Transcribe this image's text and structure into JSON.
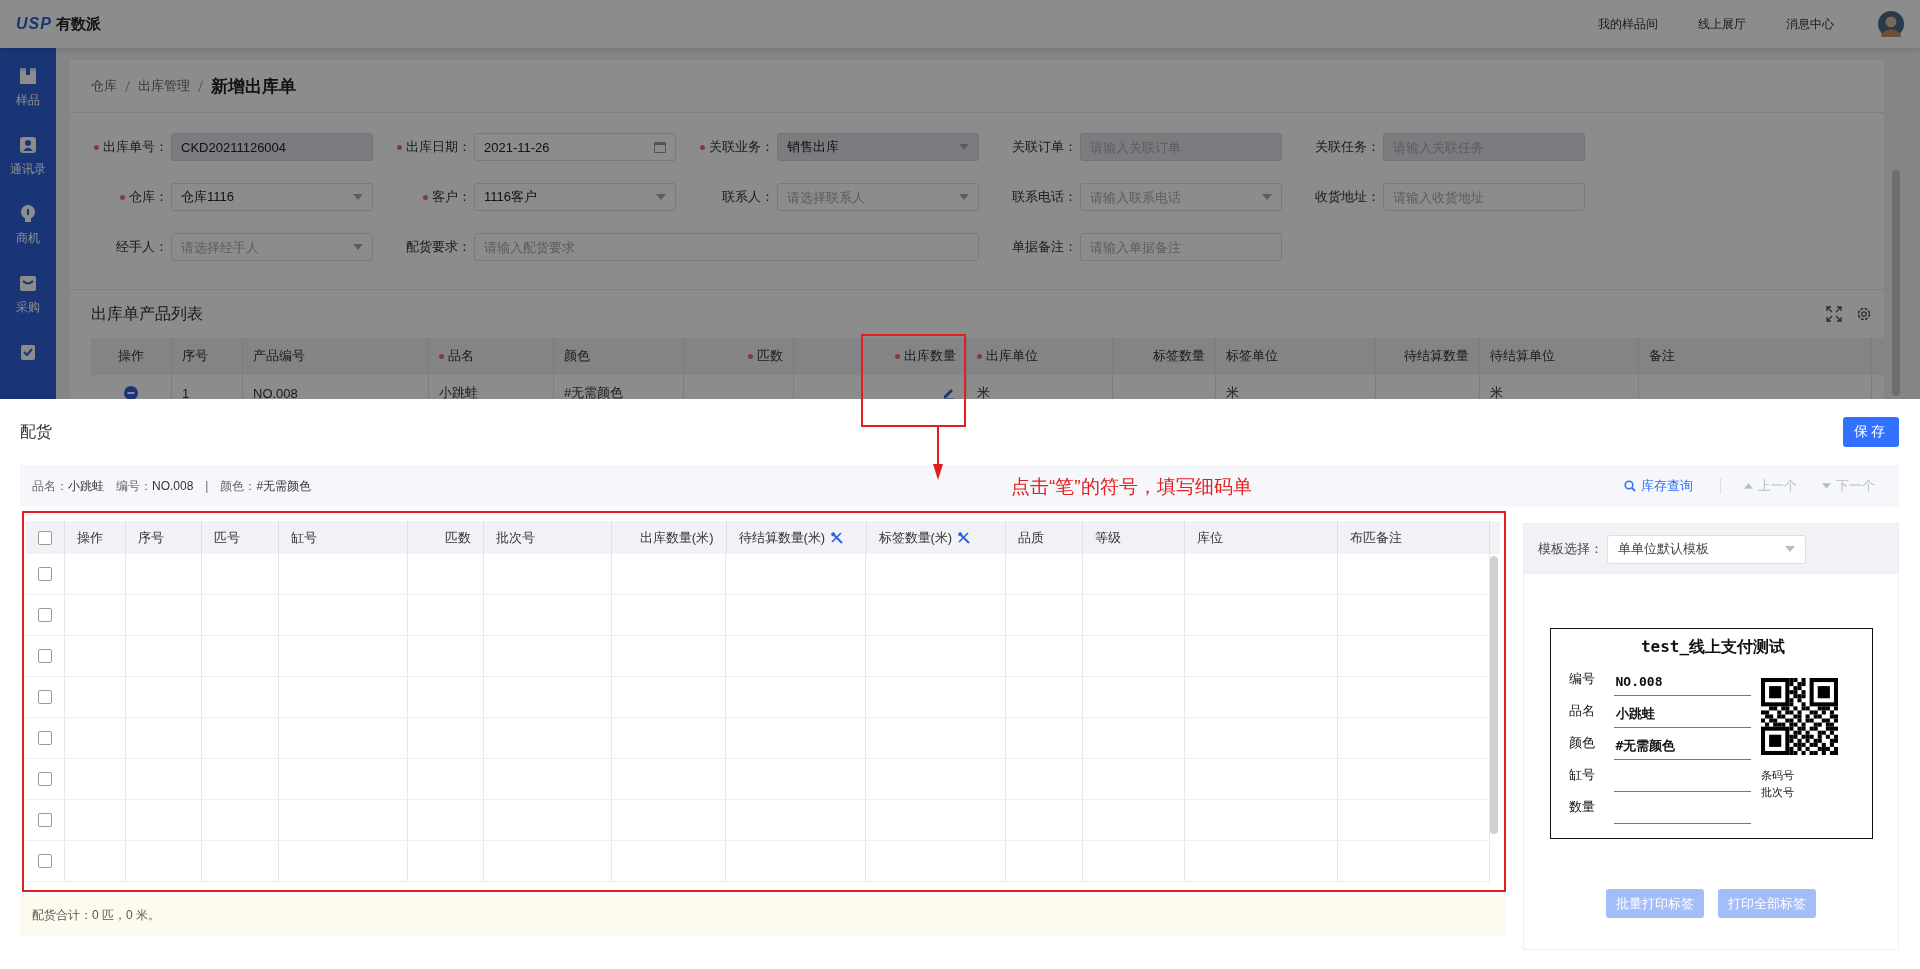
{
  "header": {
    "logo_mark": "USP",
    "logo_text": "有数派",
    "nav": [
      "我的样品间",
      "线上展厅",
      "消息中心"
    ]
  },
  "sidebar": {
    "items": [
      {
        "label": "样品",
        "selected": false
      },
      {
        "label": "通讯录",
        "selected": false
      },
      {
        "label": "商机",
        "selected": false
      },
      {
        "label": "采购",
        "selected": false
      },
      {
        "selected": false
      }
    ]
  },
  "breadcrumb": [
    "仓库",
    "出库管理",
    "新增出库单"
  ],
  "form": {
    "rows": [
      [
        {
          "label": "出库单号：",
          "required": true,
          "value": "CKD20211126004",
          "disabled": true
        },
        {
          "label": "出库日期：",
          "required": true,
          "value": "2021-11-26",
          "kind": "date",
          "disabled": false
        },
        {
          "label": "关联业务：",
          "required": true,
          "value": "销售出库",
          "kind": "select",
          "disabled": true
        },
        {
          "label": "关联订单：",
          "required": false,
          "placeholder": "请输入关联订单",
          "disabled": true
        },
        {
          "label": "关联任务：",
          "required": false,
          "placeholder": "请输入关联任务",
          "disabled": true
        }
      ],
      [
        {
          "label": "仓库：",
          "required": true,
          "value": "仓库1116",
          "kind": "select",
          "disabled": false
        },
        {
          "label": "客户：",
          "required": true,
          "value": "1116客户",
          "kind": "select",
          "disabled": false
        },
        {
          "label": "联系人：",
          "required": false,
          "placeholder": "请选择联系人",
          "kind": "select",
          "disabled": false
        },
        {
          "label": "联系电话：",
          "required": false,
          "placeholder": "请输入联系电话",
          "kind": "select",
          "disabled": false
        },
        {
          "label": "收货地址：",
          "required": false,
          "placeholder": "请输入收货地址",
          "disabled": false
        }
      ],
      [
        {
          "label": "经手人：",
          "required": false,
          "placeholder": "请选择经手人",
          "kind": "select",
          "disabled": false
        },
        {
          "label": "配货要求：",
          "required": false,
          "placeholder": "请输入配货要求",
          "disabled": false
        },
        "",
        {
          "label": "单据备注：",
          "required": false,
          "placeholder": "请输入单据备注",
          "disabled": false
        }
      ]
    ]
  },
  "products": {
    "title": "出库单产品列表",
    "columns": [
      {
        "label": "操作",
        "required": false
      },
      {
        "label": "序号",
        "required": false
      },
      {
        "label": "产品编号",
        "required": false
      },
      {
        "label": "品名",
        "required": true
      },
      {
        "label": "颜色",
        "required": false
      },
      {
        "label": "匹数",
        "required": true
      },
      {
        "label": "出库数量",
        "required": true
      },
      {
        "label": "出库单位",
        "required": true
      },
      {
        "label": "标签数量",
        "required": false
      },
      {
        "label": "标签单位",
        "required": false
      },
      {
        "label": "待结算数量",
        "required": false
      },
      {
        "label": "待结算单位",
        "required": false
      },
      {
        "label": "备注",
        "required": false
      }
    ],
    "rows": [
      {
        "cells": [
          {
            "kind": "action"
          },
          {
            "text": "1"
          },
          {
            "text": "NO.008"
          },
          {
            "text": "小跳蛙"
          },
          {
            "text": "#无需颜色"
          },
          {},
          {
            "kind": "edit"
          },
          {
            "text": "米"
          },
          {},
          {
            "text": "米"
          },
          {},
          {
            "text": "米"
          },
          {}
        ]
      }
    ]
  },
  "annotation": {
    "text": "点击“笔”的符号，填写细码单"
  },
  "modal": {
    "title": "配货",
    "save": "保存",
    "info": [
      {
        "label": "品名：",
        "value": "小跳蛙"
      },
      {
        "label": "编号：",
        "value": "NO.008"
      },
      {
        "separator": "|"
      },
      {
        "label": "颜色：",
        "value": "#无需颜色"
      }
    ],
    "actions": [
      {
        "label": "库存查询",
        "kind": "search",
        "disabled": false
      },
      {
        "label": "上一个",
        "kind": "prev",
        "disabled": true
      },
      {
        "label": "下一个",
        "kind": "next",
        "disabled": true
      }
    ],
    "table": {
      "all_checked": false,
      "columns": [
        {
          "label": "操作",
          "kind": "plain"
        },
        {
          "label": "序号",
          "kind": "plain"
        },
        {
          "label": "匹号",
          "kind": "plain"
        },
        {
          "label": "缸号",
          "kind": "plain"
        },
        {
          "label": "匹数",
          "kind": "plain"
        },
        {
          "label": "批次号",
          "kind": "plain"
        },
        {
          "label": "出库数量(米)",
          "kind": "plain"
        },
        {
          "label": "待结算数量(米)",
          "kind": "tool"
        },
        {
          "label": "标签数量(米)",
          "kind": "tool"
        },
        {
          "label": "品质",
          "kind": "plain"
        },
        {
          "label": "等级",
          "kind": "plain"
        },
        {
          "label": "库位",
          "kind": "plain"
        },
        {
          "label": "布匹备注",
          "kind": "plain"
        }
      ],
      "rows": [
        {
          "checked": false
        },
        {
          "checked": false
        },
        {
          "checked": false
        },
        {
          "checked": false
        },
        {
          "checked": false
        },
        {
          "checked": false
        },
        {
          "checked": false
        },
        {
          "checked": false
        }
      ]
    },
    "summary": "配货合计：0 匹，0 米。",
    "template": {
      "label": "模板选择：",
      "value": "单单位默认模板"
    },
    "tag": {
      "title": "test_线上支付测试",
      "fields": [
        {
          "label": "编号",
          "value": "NO.008"
        },
        {
          "label": "品名",
          "value": "小跳蛙"
        },
        {
          "label": "颜色",
          "value": "#无需颜色"
        },
        {
          "label": "缸号"
        },
        {
          "label": "数量"
        }
      ],
      "side": [
        "条码号",
        "批次号"
      ]
    },
    "buttons": [
      {
        "label": "批量打印标签",
        "disabled": true
      },
      {
        "label": "打印全部标签",
        "disabled": true
      }
    ]
  }
}
